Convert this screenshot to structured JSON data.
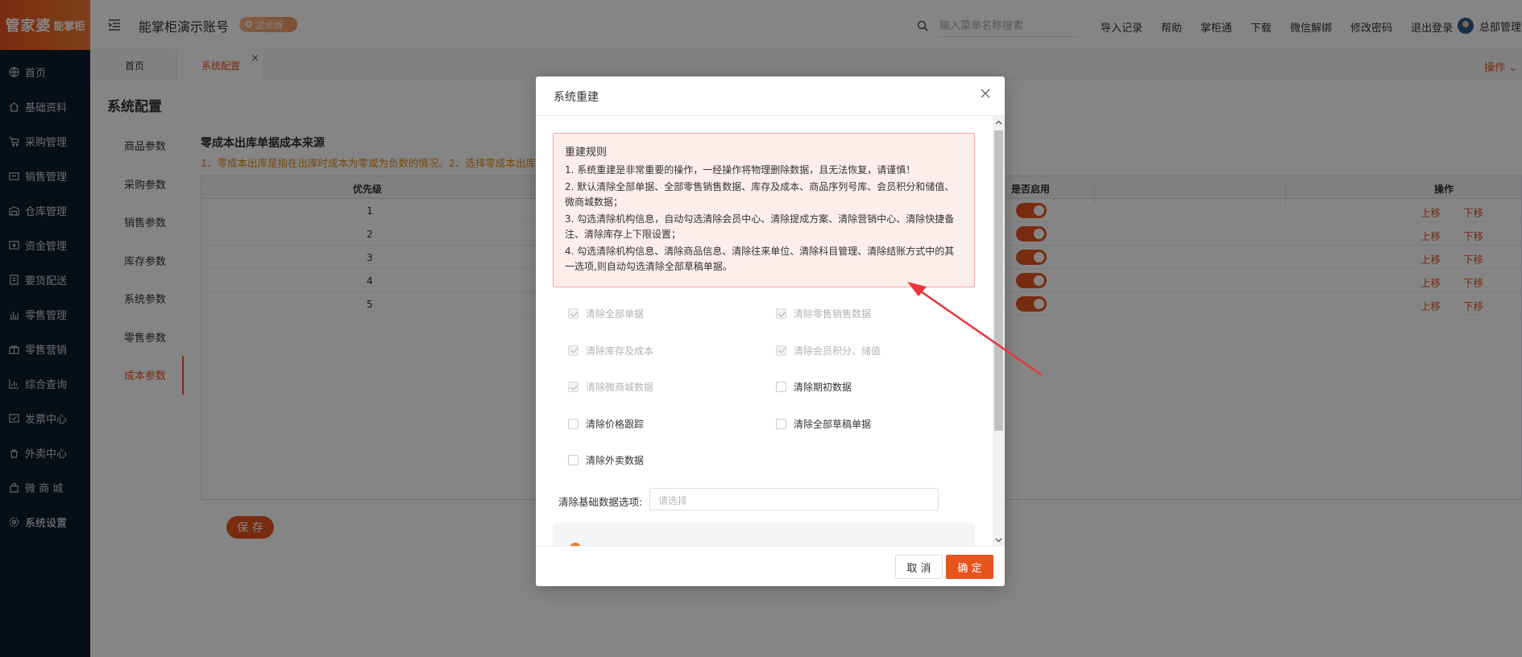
{
  "brand": {
    "logo_main": "管家婆",
    "logo_sub": "能掌柜"
  },
  "sidebar": {
    "items": [
      {
        "label": "首页",
        "icon": "globe-icon"
      },
      {
        "label": "基础资料",
        "icon": "home-icon"
      },
      {
        "label": "采购管理",
        "icon": "cart-icon"
      },
      {
        "label": "销售管理",
        "icon": "sales-icon"
      },
      {
        "label": "仓库管理",
        "icon": "warehouse-icon"
      },
      {
        "label": "资金管理",
        "icon": "money-icon"
      },
      {
        "label": "要货配送",
        "icon": "delivery-icon"
      },
      {
        "label": "零售管理",
        "icon": "retail-chart-icon"
      },
      {
        "label": "零售营销",
        "icon": "gift-icon"
      },
      {
        "label": "综合查询",
        "icon": "query-chart-icon"
      },
      {
        "label": "发票中心",
        "icon": "invoice-icon"
      },
      {
        "label": "外卖中心",
        "icon": "takeout-icon"
      },
      {
        "label": "微 商 城",
        "icon": "shop-bag-icon"
      },
      {
        "label": "系统设置",
        "icon": "gear-icon"
      }
    ]
  },
  "header": {
    "account": "能掌柜演示账号",
    "badge": "企业版",
    "search_placeholder": "输入菜单名称搜索",
    "links": [
      "导入记录",
      "帮助",
      "掌柜通",
      "下载",
      "微信解绑",
      "修改密码",
      "退出登录"
    ],
    "user": "总部管理"
  },
  "tabs": {
    "home": "首页",
    "current": "系统配置",
    "ops": "操作"
  },
  "page": {
    "title": "系统配置",
    "subnav": [
      "商品参数",
      "采购参数",
      "销售参数",
      "库存参数",
      "系统参数",
      "零售参数",
      "成本参数"
    ],
    "section_title": "零成本出库单据成本来源",
    "section_note": "1、零成本出库是指在出库时成本为零或为负数的情况。2、选择零成本出库",
    "table": {
      "headers": [
        "优先级",
        "是否启用",
        "操作"
      ],
      "rows": [
        "1",
        "2",
        "3",
        "4",
        "5"
      ],
      "move_up": "上移",
      "move_down": "下移"
    },
    "save": "保 存"
  },
  "dialog": {
    "title": "系统重建",
    "rules_title": "重建规则",
    "rules": [
      "1. 系统重建是非常重要的操作，一经操作将物理删除数据，且无法恢复，请谨慎！",
      "2. 默认清除全部单据、全部零售销售数据、库存及成本、商品序列号库、会员积分和储值、微商城数据；",
      "3. 勾选清除机构信息，自动勾选清除会员中心、清除提成方案、清除营销中心、清除快捷备注、清除库存上下限设置；",
      "4. 勾选清除机构信息、清除商品信息、清除往来单位、清除科目管理、清除结账方式中的其一选项,则自动勾选清除全部草稿单据。"
    ],
    "checks": [
      {
        "label": "清除全部单据",
        "checked": true,
        "disabled": true
      },
      {
        "label": "清除零售销售数据",
        "checked": true,
        "disabled": true
      },
      {
        "label": "清除库存及成本",
        "checked": true,
        "disabled": true
      },
      {
        "label": "清除会员积分、储值",
        "checked": true,
        "disabled": true
      },
      {
        "label": "清除微商城数据",
        "checked": true,
        "disabled": true
      },
      {
        "label": "清除期初数据",
        "checked": false,
        "disabled": false
      },
      {
        "label": "清除价格跟踪",
        "checked": false,
        "disabled": false
      },
      {
        "label": "清除全部草稿单据",
        "checked": false,
        "disabled": false
      },
      {
        "label": "清除外卖数据",
        "checked": false,
        "disabled": false
      }
    ],
    "basic_label": "清除基础数据选项:",
    "basic_placeholder": "请选择",
    "cancel": "取 消",
    "ok": "确 定"
  },
  "colors": {
    "accent": "#e8541e",
    "sidebar": "#0c1b2f",
    "warning_text": "#e88a12",
    "annotation_arrow": "#e8363a"
  }
}
